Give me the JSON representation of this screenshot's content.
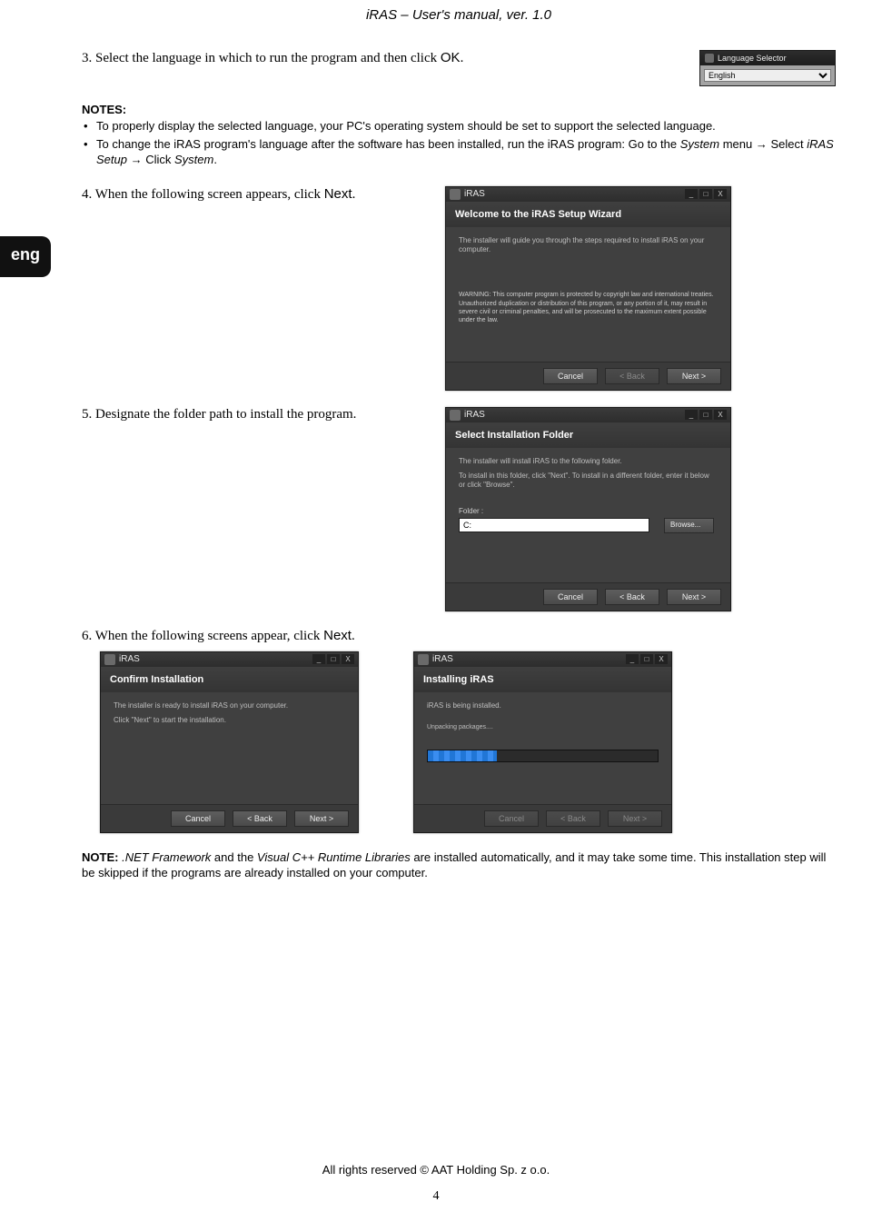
{
  "doc": {
    "header": "iRAS – User's manual, ver. 1.0",
    "footer": "All rights reserved © AAT Holding Sp. z o.o.",
    "page_number": "4"
  },
  "lang_tab": "eng",
  "steps": {
    "s3": {
      "num": "3.",
      "prefix": "Select the language in which to run the program and then click ",
      "ok": "OK",
      "suffix": "."
    },
    "s4": {
      "num": "4.",
      "prefix": "When the following screen appears, click ",
      "next": "Next",
      "suffix": "."
    },
    "s5": {
      "num": "5.",
      "text": "Designate the folder path to install the program."
    },
    "s6": {
      "num": "6.",
      "prefix": "When the following screens appear, click ",
      "next": "Next",
      "suffix": "."
    }
  },
  "notes1": {
    "heading": "NOTES:",
    "bullet1": "To properly display the selected language, your PC's operating system should be set to support the selected language.",
    "bullet2_a": "To change the iRAS program's language after the software has been installed, run the iRAS program:  Go to the ",
    "bullet2_b": "System",
    "bullet2_c": " menu → Select ",
    "bullet2_d": "iRAS Setup",
    "bullet2_e": " → Click ",
    "bullet2_f": "System",
    "bullet2_g": "."
  },
  "langsel": {
    "title": "Language Selector",
    "value": "English"
  },
  "dlg_welcome": {
    "title": "iRAS",
    "heading": "Welcome to the iRAS Setup Wizard",
    "body": "The installer will guide you through the steps required to install iRAS on your computer.",
    "warning": "WARNING: This computer program is protected by copyright law and international treaties. Unauthorized duplication or distribution of this program, or any portion of it, may result in severe civil or criminal penalties, and will be prosecuted to the maximum extent possible under the law.",
    "btn_cancel": "Cancel",
    "btn_back": "< Back",
    "btn_next": "Next >"
  },
  "dlg_folder": {
    "title": "iRAS",
    "heading": "Select Installation Folder",
    "line1": "The installer will install iRAS to the following folder.",
    "line2": "To install in this folder, click \"Next\". To install in a different folder, enter it below or click \"Browse\".",
    "folder_label": "Folder :",
    "folder_value": "C:",
    "btn_browse": "Browse...",
    "btn_cancel": "Cancel",
    "btn_back": "< Back",
    "btn_next": "Next >"
  },
  "dlg_confirm": {
    "title": "iRAS",
    "heading": "Confirm Installation",
    "line1": "The installer is ready to install iRAS on your computer.",
    "line2": "Click \"Next\" to start the installation.",
    "btn_cancel": "Cancel",
    "btn_back": "< Back",
    "btn_next": "Next >"
  },
  "dlg_installing": {
    "title": "iRAS",
    "heading": "Installing iRAS",
    "line1": "iRAS is being installed.",
    "status": "Unpacking packages....",
    "btn_cancel": "Cancel",
    "btn_back": "< Back",
    "btn_next": "Next >"
  },
  "note_bottom": {
    "label": "NOTE:",
    "a": " ",
    "net": ".NET Framework",
    "b": " and the ",
    "vc": "Visual C++ Runtime Libraries",
    "c": " are installed automatically, and it may take some time.  This installation step will be skipped if the programs are already installed on your computer."
  },
  "winbtns": {
    "min": "_",
    "max": "□",
    "close": "X"
  }
}
